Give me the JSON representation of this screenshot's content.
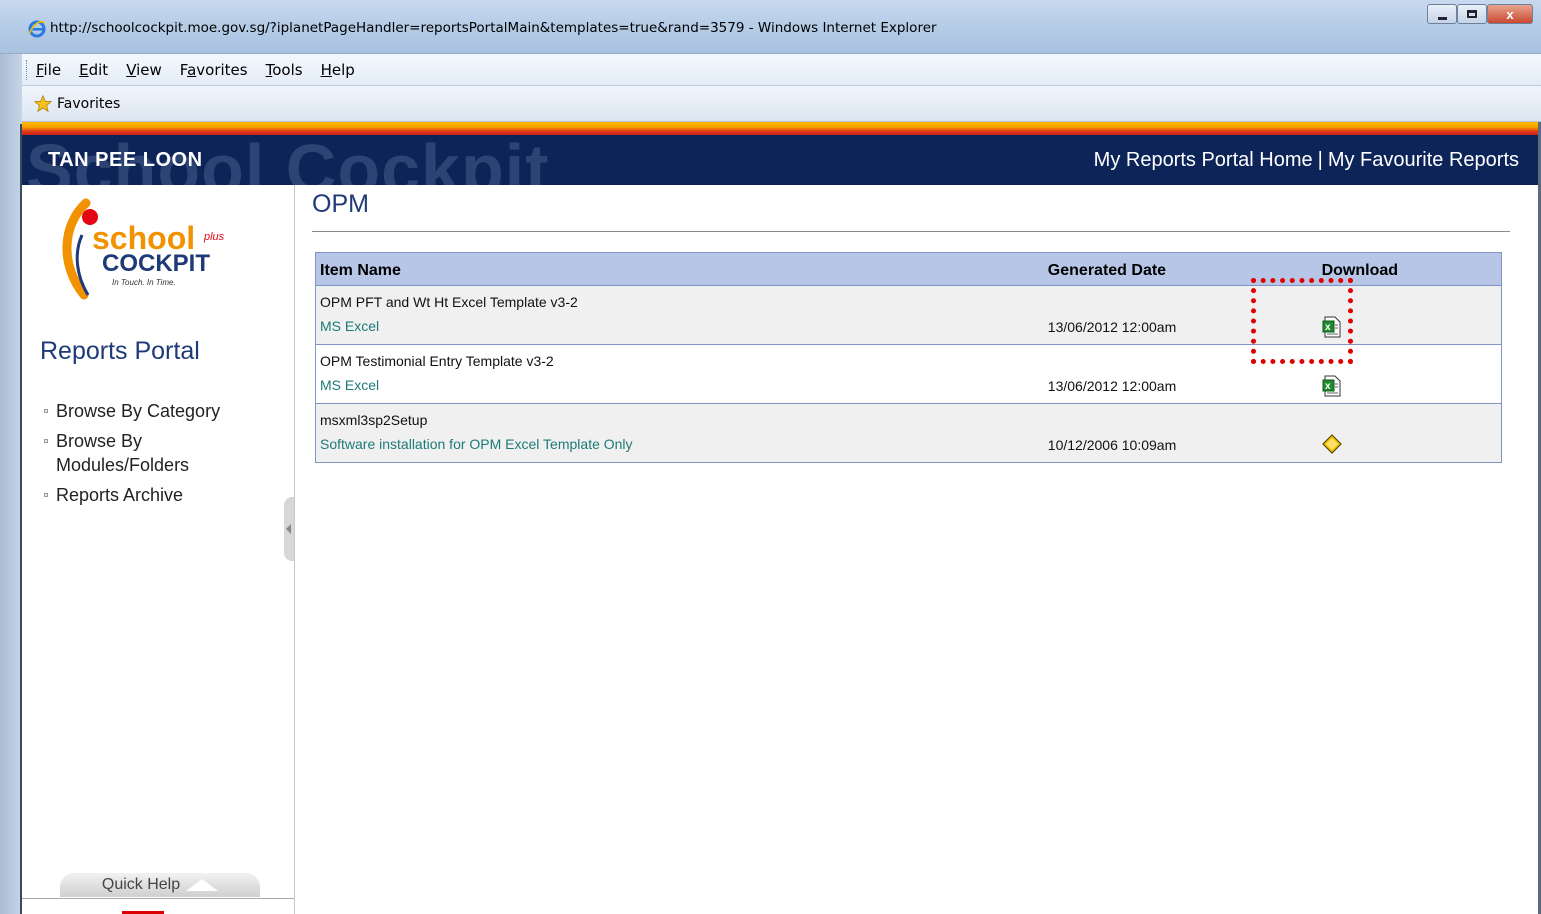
{
  "window": {
    "title": "http://schoolcockpit.moe.gov.sg/?iplanetPageHandler=reportsPortalMain&templates=true&rand=3579  - Windows Internet Explorer",
    "close_glyph": "x"
  },
  "menubar": {
    "items": [
      {
        "pre": "",
        "u": "F",
        "post": "ile"
      },
      {
        "pre": "",
        "u": "E",
        "post": "dit"
      },
      {
        "pre": "",
        "u": "V",
        "post": "iew"
      },
      {
        "pre": "F",
        "u": "a",
        "post": "vorites"
      },
      {
        "pre": "",
        "u": "T",
        "post": "ools"
      },
      {
        "pre": "",
        "u": "H",
        "post": "elp"
      }
    ]
  },
  "favorites_bar": {
    "label": "Favorites"
  },
  "header": {
    "watermark": "School Cockpit",
    "user_name": "TAN PEE LOON",
    "link_home": "My Reports Portal Home",
    "link_sep": "|",
    "link_fav": "My Favourite Reports"
  },
  "logo": {
    "word1": "school",
    "word2": "COCKPIT",
    "plus": "plus",
    "tagline": "In Touch. In Time."
  },
  "sidebar": {
    "title": "Reports Portal",
    "links": [
      "Browse By Category",
      "Browse By Modules/Folders",
      "Reports Archive"
    ],
    "quick_help": "Quick Help"
  },
  "main": {
    "heading": "OPM",
    "columns": {
      "name": "Item Name",
      "date": "Generated Date",
      "download": "Download"
    },
    "rows": [
      {
        "name": "OPM PFT and Wt Ht Excel Template v3-2",
        "type": "MS Excel",
        "date": "13/06/2012 12:00am",
        "icon": "excel-file-icon"
      },
      {
        "name": "OPM Testimonial Entry Template v3-2",
        "type": "MS Excel",
        "date": "13/06/2012 12:00am",
        "icon": "excel-file-icon"
      },
      {
        "name": "msxml3sp2Setup",
        "type": "Software installation for OPM Excel Template Only",
        "date": "10/12/2006 10:09am",
        "icon": "setup-file-icon"
      }
    ]
  },
  "colors": {
    "header_navy": "#0d2458",
    "accent_orange": "#f7a200",
    "accent_red": "#e43d1a",
    "link_teal": "#1d7a78",
    "highlight_red": "#e00000"
  }
}
